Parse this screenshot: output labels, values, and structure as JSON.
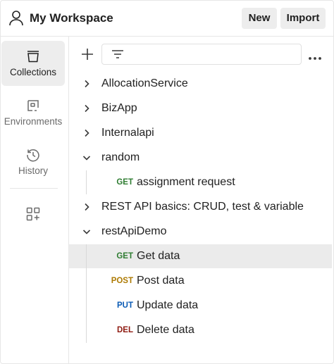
{
  "header": {
    "workspace_title": "My Workspace",
    "new_label": "New",
    "import_label": "Import",
    "workspace_icon": "user-icon"
  },
  "sidebar": {
    "items": [
      {
        "label": "Collections",
        "icon": "trash-bin-icon",
        "active": true
      },
      {
        "label": "Environments",
        "icon": "environment-icon",
        "active": false
      },
      {
        "label": "History",
        "icon": "history-icon",
        "active": false
      }
    ],
    "extra_icon": "add-widget-icon"
  },
  "toolbar": {
    "add_icon": "plus-icon",
    "filter_icon": "filter-icon",
    "more_icon": "more-icon",
    "filter_value": ""
  },
  "collections": [
    {
      "name": "AllocationService",
      "expanded": false
    },
    {
      "name": "BizApp",
      "expanded": false
    },
    {
      "name": "Internalapi",
      "expanded": false
    },
    {
      "name": "random",
      "expanded": true,
      "requests": [
        {
          "method": "GET",
          "name": "assignment request"
        }
      ]
    },
    {
      "name": "REST API basics: CRUD, test & variable",
      "expanded": false
    },
    {
      "name": "restApiDemo",
      "expanded": true,
      "requests": [
        {
          "method": "GET",
          "name": "Get data",
          "selected": true
        },
        {
          "method": "POST",
          "name": "Post data"
        },
        {
          "method": "PUT",
          "name": "Update data"
        },
        {
          "method": "DEL",
          "name": "Delete data"
        }
      ]
    }
  ],
  "method_colors": {
    "GET": "#2f7d32",
    "POST": "#ad7a03",
    "PUT": "#0b5bb5",
    "DEL": "#8e1a10"
  }
}
